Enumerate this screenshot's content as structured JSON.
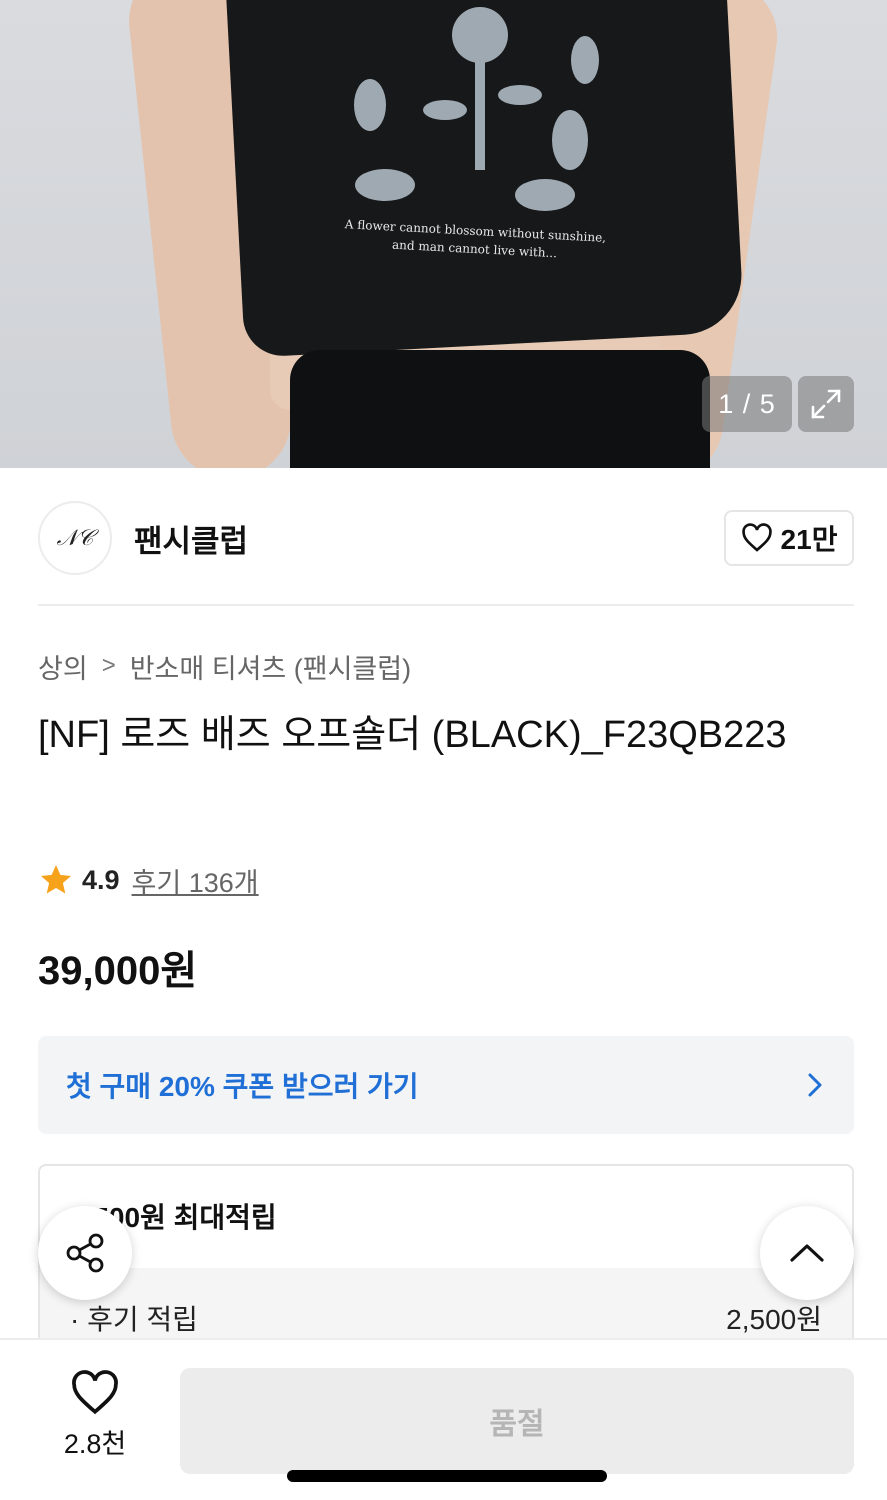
{
  "gallery": {
    "counter": "1 / 5",
    "print_text_line1": "A flower cannot blossom without sunshine,",
    "print_text_line2": "and man cannot live with..."
  },
  "brand": {
    "logo_text": "𝒩𝒞",
    "name": "팬시클럽",
    "likes": "21만"
  },
  "breadcrumb": {
    "category": "상의",
    "subcategory": "반소매 티셔츠 (팬시클럽)"
  },
  "product": {
    "title": "[NF] 로즈 배즈 오프숄더 (BLACK)_F23QB223",
    "rating": "4.9",
    "reviews_label": "후기 136개",
    "price": "39,000원"
  },
  "coupon": {
    "label": "첫 구매 20% 쿠폰 받으러 가기"
  },
  "points": {
    "header": "2,500원 최대적립",
    "row_label": "· 후기 적립",
    "row_value": "2,500원"
  },
  "bottom": {
    "wish_count": "2.8천",
    "buy_label": "품절"
  },
  "colors": {
    "accent_blue": "#1f6fd6",
    "star": "#f7a21b"
  }
}
